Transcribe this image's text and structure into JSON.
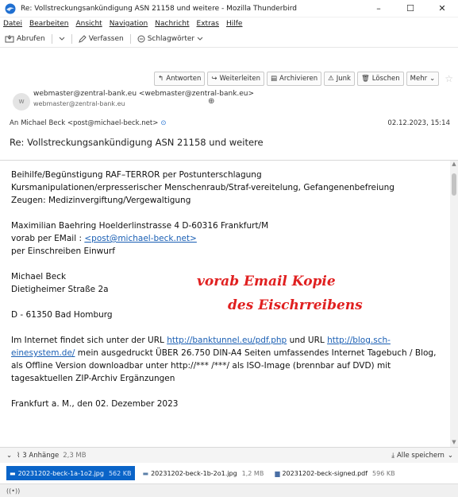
{
  "window": {
    "title": "Re: Vollstreckungsankündigung ASN 21158 und weitere - Mozilla Thunderbird",
    "minimize": "–",
    "maximize": "☐",
    "close": "✕"
  },
  "menu": [
    "Datei",
    "Bearbeiten",
    "Ansicht",
    "Navigation",
    "Nachricht",
    "Extras",
    "Hilfe"
  ],
  "toolbar": {
    "fetch_label": "Abrufen",
    "compose_label": "Verfassen",
    "tags_label": "Schlagwörter"
  },
  "actions": {
    "reply": "Antworten",
    "forward": "Weiterleiten",
    "archive": "Archivieren",
    "junk": "Junk",
    "delete": "Löschen",
    "more": "Mehr"
  },
  "header": {
    "avatar_letter": "w",
    "from_line": "webmaster@zentral-bank.eu <webmaster@zentral-bank.eu>",
    "from_sub": "webmaster@zentral-bank.eu",
    "to_label": "An",
    "to_value": "Michael Beck <post@michael-beck.net>",
    "date": "02.12.2023, 15:14",
    "subject": "Re: Vollstreckungsankündigung ASN 21158 und weitere"
  },
  "body": {
    "l1": "Beihilfe/Begünstigung RAF–TERROR per Postunterschlagung",
    "l2": "Kursmanipulationen/erpresserischer Menschenraub/Straf-vereitelung, Gefangenenbefreiung",
    "l3": "Zeugen: Medizinvergiftung/Vergewaltigung",
    "l4": "Maximilian Baehring Hoelderlinstrasse 4 D-60316 Frankfurt/M",
    "l5_prefix": "vorab per EMail : ",
    "l5_link": "<post@michael-beck.net>",
    "l6": "per Einschreiben Einwurf",
    "l7": "Michael Beck",
    "l8": "Dietigheimer Straße 2a",
    "l9": "D - 61350 Bad Homburg",
    "p_a": "Im Internet findet sich unter der URL ",
    "p_link1": "http://banktunnel.eu/pdf.php",
    "p_b": " und URL ",
    "p_link2a": "http://blog.sch-",
    "p_link2b": "einesystem.de/",
    "p_c": " mein ausgedruckt ÜBER 26.750 DIN-A4 Seiten umfassendes Internet Tagebuch / Blog, als Offline Version downloadbar unter http://*** /***/ als ISO-Image (brennbar auf DVD) mit tagesaktuellen ZIP-Archiv Ergänzungen",
    "l10": "Frankfurt a. M., den 02. Dezember 2023",
    "stamp1": "vorab Email Kopie",
    "stamp2": "des Eischrreibens"
  },
  "attachments": {
    "summary": "3 Anhänge",
    "total": "2,3 MB",
    "save_all": "Alle speichern",
    "files": [
      {
        "name": "20231202-beck-1a-1o2.jpg",
        "size": "562 KB"
      },
      {
        "name": "20231202-beck-1b-2o1.jpg",
        "size": "1,2 MB"
      },
      {
        "name": "20231202-beck-signed.pdf",
        "size": "596 KB"
      }
    ]
  },
  "status": {
    "icon": "((•))"
  },
  "colors": {
    "accent": "#0a64c8",
    "stamp": "#e02020",
    "link": "#1a5fb4"
  }
}
